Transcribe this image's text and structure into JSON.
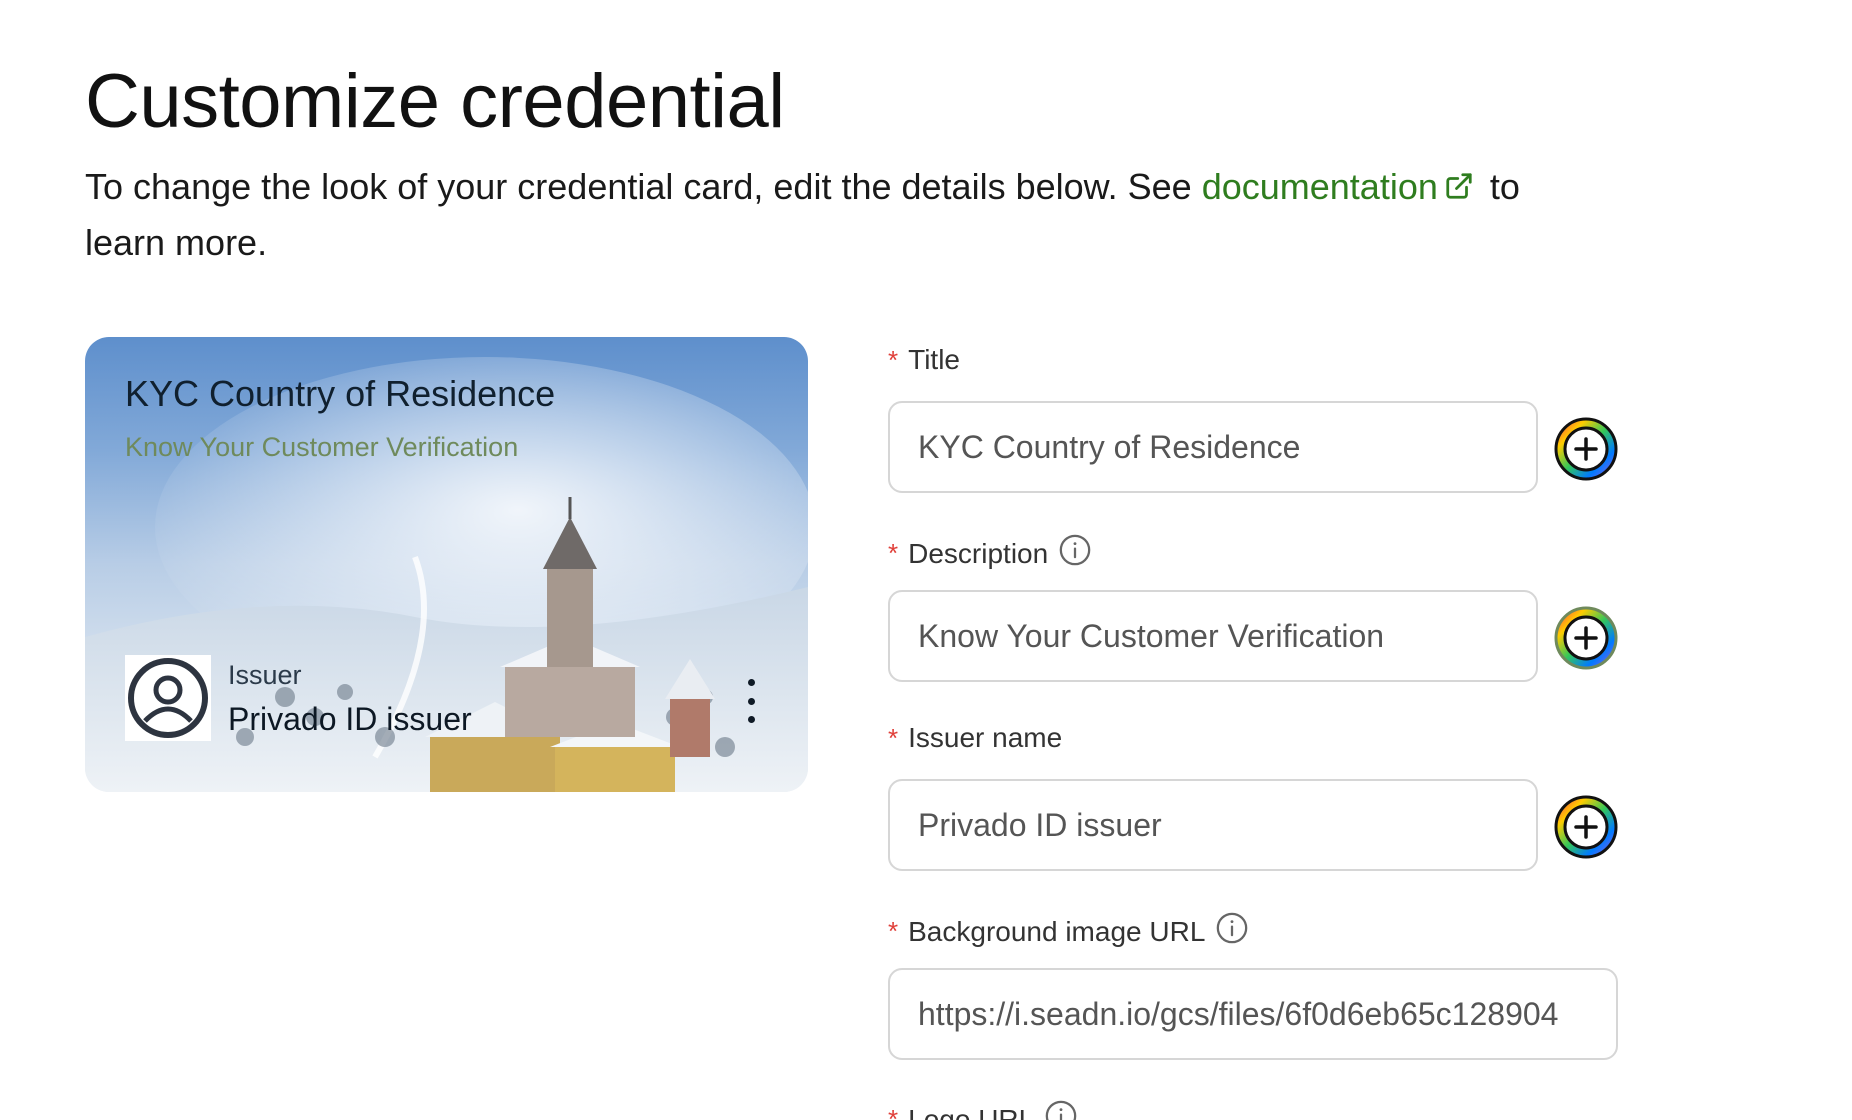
{
  "header": {
    "title": "Customize credential",
    "intro_before": "To change the look of your credential card, edit the details below. See ",
    "doc_link": "documentation",
    "intro_after": " to learn more."
  },
  "card": {
    "title": "KYC Country of Residence",
    "description": "Know Your Customer Verification",
    "issuer_label": "Issuer",
    "issuer_name": "Privado ID issuer"
  },
  "form": {
    "title_label": "Title",
    "title_value": "KYC Country of Residence",
    "description_label": "Description",
    "description_value": "Know Your Customer Verification",
    "issuer_label": "Issuer name",
    "issuer_value": "Privado ID issuer",
    "background_label": "Background image URL",
    "background_value": "https://i.seadn.io/gcs/files/6f0d6eb65c128904",
    "logo_label": "Logo URL",
    "required_mark": "*"
  },
  "colors": {
    "link": "#2f7d1f",
    "required": "#e0403a",
    "description_text": "#6f8a5c"
  },
  "icons": {
    "external_link": "external-link-icon",
    "info": "info-icon",
    "color_picker": "color-picker-icon",
    "avatar": "user-avatar-icon",
    "menu": "more-vertical-icon"
  }
}
